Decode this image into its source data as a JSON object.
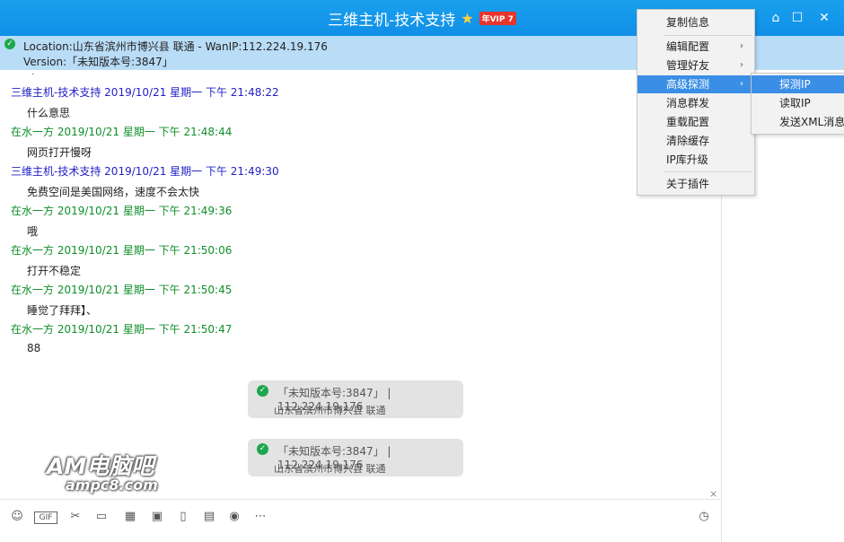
{
  "window": {
    "title": "三维主机-技术支持",
    "vip_badge": "年VIP 7",
    "controls": {
      "skin": "⌂",
      "minimize": "—",
      "maximize": "☐",
      "close": "✕"
    }
  },
  "banner": {
    "location": "Location:山东省滨州市博兴县 联通 - WanIP:112.224.19.176",
    "version": "Version:「未知版本号:3847」"
  },
  "messages": [
    {
      "sender": "三维主机-技术支持",
      "time": "2019/10/21 星期一 下午 21:48:22",
      "text": "什么意思",
      "color": "#2121c7"
    },
    {
      "sender": "在水一方",
      "time": "2019/10/21 星期一 下午 21:48:44",
      "text": "网页打开慢呀",
      "color": "#0e8f2a"
    },
    {
      "sender": "三维主机-技术支持",
      "time": "2019/10/21 星期一 下午 21:49:30",
      "text": "免费空间是美国网络，速度不会太快",
      "color": "#2121c7"
    },
    {
      "sender": "在水一方",
      "time": "2019/10/21 星期一 下午 21:49:36",
      "text": "哦",
      "color": "#0e8f2a"
    },
    {
      "sender": "在水一方",
      "time": "2019/10/21 星期一 下午 21:50:06",
      "text": "打开不稳定",
      "color": "#0e8f2a"
    },
    {
      "sender": "在水一方",
      "time": "2019/10/21 星期一 下午 21:50:45",
      "text": "睡觉了拜拜】、",
      "color": "#0e8f2a"
    },
    {
      "sender": "在水一方",
      "time": "2019/10/21 星期一 下午 21:50:47",
      "text": "88",
      "color": "#0e8f2a"
    }
  ],
  "system_cards": [
    {
      "line1": "「未知版本号:3847」 | 112.224.19.176",
      "line2": "山东省滨州市博兴县 联通"
    },
    {
      "line1": "「未知版本号:3847」 | 112.224.19.176",
      "line2": "山东省滨州市博兴县 联通"
    }
  ],
  "watermark": {
    "line1": "AM电脑吧",
    "line2": "ampc8.com"
  },
  "context_menu": {
    "items": [
      {
        "label": "复制信息",
        "submenu": false
      },
      {
        "label": "编辑配置",
        "submenu": true
      },
      {
        "label": "管理好友",
        "submenu": true
      },
      {
        "label": "高级探测",
        "submenu": true,
        "highlighted": true
      },
      {
        "label": "消息群发",
        "submenu": false
      },
      {
        "label": "重载配置",
        "submenu": false
      },
      {
        "label": "清除缓存",
        "submenu": false
      },
      {
        "label": "IP库升级",
        "submenu": false
      },
      {
        "label": "关于插件",
        "submenu": false
      }
    ],
    "submenu_items": [
      {
        "label": "探测IP",
        "highlighted": true
      },
      {
        "label": "读取IP"
      },
      {
        "label": "发送XML消息"
      }
    ]
  },
  "toolbar": {
    "icons": [
      "emoji-icon",
      "gif-icon",
      "scissors-icon",
      "folder-icon",
      "image-edit-icon",
      "picture-icon",
      "shake-icon",
      "calendar-icon",
      "redpacket-icon",
      "more-icon"
    ],
    "history_icon": "clock-icon"
  }
}
